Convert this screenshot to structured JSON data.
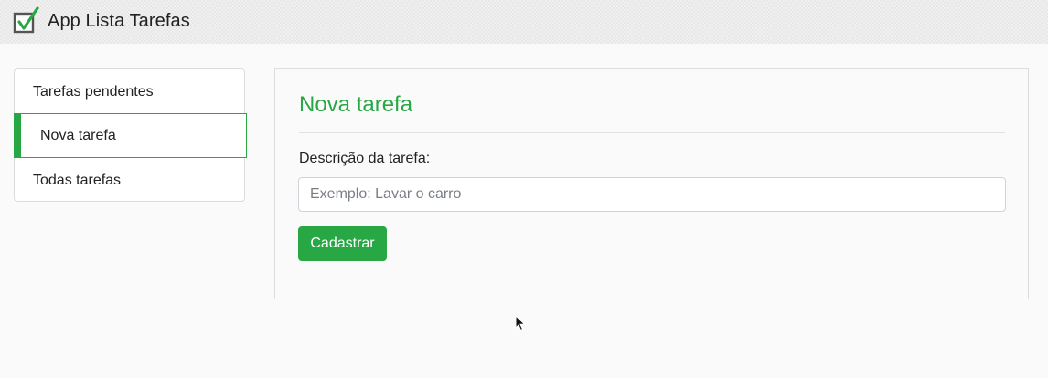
{
  "header": {
    "app_title": "App Lista Tarefas",
    "logo_icon": "checkbox-checked-icon"
  },
  "sidebar": {
    "items": [
      {
        "label": "Tarefas pendentes",
        "active": false
      },
      {
        "label": "Nova tarefa",
        "active": true
      },
      {
        "label": "Todas tarefas",
        "active": false
      }
    ]
  },
  "main": {
    "title": "Nova tarefa",
    "form": {
      "description_label": "Descrição da tarefa:",
      "description_value": "",
      "description_placeholder": "Exemplo: Lavar o carro",
      "submit_label": "Cadastrar"
    }
  },
  "colors": {
    "accent": "#28a745",
    "text": "#222222",
    "border": "#dddddd"
  }
}
